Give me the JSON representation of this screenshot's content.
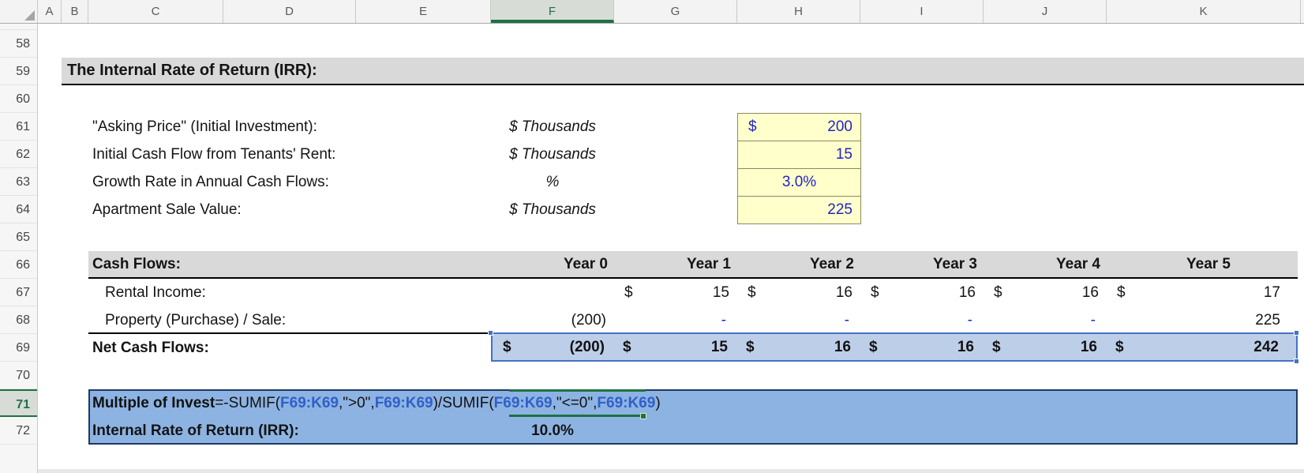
{
  "columns": [
    "A",
    "B",
    "C",
    "D",
    "E",
    "F",
    "G",
    "H",
    "I",
    "J",
    "K"
  ],
  "active_column": "F",
  "rows": [
    "58",
    "59",
    "60",
    "61",
    "62",
    "63",
    "64",
    "65",
    "66",
    "67",
    "68",
    "69",
    "70",
    "71",
    "72"
  ],
  "active_row": "71",
  "section_title": "The Internal Rate of Return (IRR):",
  "inputs": {
    "rows": [
      {
        "label": "\"Asking Price\" (Initial Investment):",
        "unit": "$ Thousands",
        "currency": "$",
        "value": "200"
      },
      {
        "label": "Initial Cash Flow from Tenants' Rent:",
        "unit": "$ Thousands",
        "currency": "",
        "value": "15"
      },
      {
        "label": "Growth Rate in Annual Cash Flows:",
        "unit": "%",
        "currency": "",
        "value": "3.0%"
      },
      {
        "label": "Apartment Sale Value:",
        "unit": "$ Thousands",
        "currency": "",
        "value": "225"
      }
    ]
  },
  "cash_flows": {
    "section_label": "Cash Flows:",
    "year_headers": [
      "Year 0",
      "Year 1",
      "Year 2",
      "Year 3",
      "Year 4",
      "Year 5"
    ],
    "rental_income": {
      "label": "Rental Income:",
      "cur1": "$",
      "val1": "15",
      "cur2": "$",
      "val2": "16",
      "cur3": "$",
      "val3": "16",
      "cur4": "$",
      "val4": "16",
      "cur5": "$",
      "val5": "17"
    },
    "property": {
      "label": "Property (Purchase) / Sale:",
      "val0": "(200)",
      "dash1": "-",
      "dash2": "-",
      "dash3": "-",
      "dash4": "-",
      "val5": "225"
    },
    "net": {
      "label": "Net Cash Flows:",
      "cur0": "$",
      "val0": "(200)",
      "cur1": "$",
      "val1": "15",
      "cur2": "$",
      "val2": "16",
      "cur3": "$",
      "val3": "16",
      "cur4": "$",
      "val4": "16",
      "cur5": "$",
      "val5": "242"
    }
  },
  "summary": {
    "multiple_label": "Multiple of Invest",
    "formula": {
      "s0": "=-SUMIF(",
      "r1": "F69:K69",
      "s1": ",\">0\",",
      "r2": "F69:K69",
      "s2": ")/SUMIF(",
      "r3": "F69:K69",
      "s3": ",\"<=0\",",
      "r4": "F69:K69",
      "s4": ")"
    },
    "irr_label": "Internal Rate of Return (IRR):",
    "irr_value": "10.0%"
  },
  "colors": {
    "input_fill": "#FFFFCC",
    "input_text": "#2323C8",
    "selection_fill": "#BDCEE9",
    "selection_border": "#4472C4",
    "block_fill": "#8DB3E2",
    "block_border": "#1F3864",
    "band_fill": "#D9D9D9",
    "active_green": "#1E7145",
    "formula_ref": "#3060C8"
  }
}
